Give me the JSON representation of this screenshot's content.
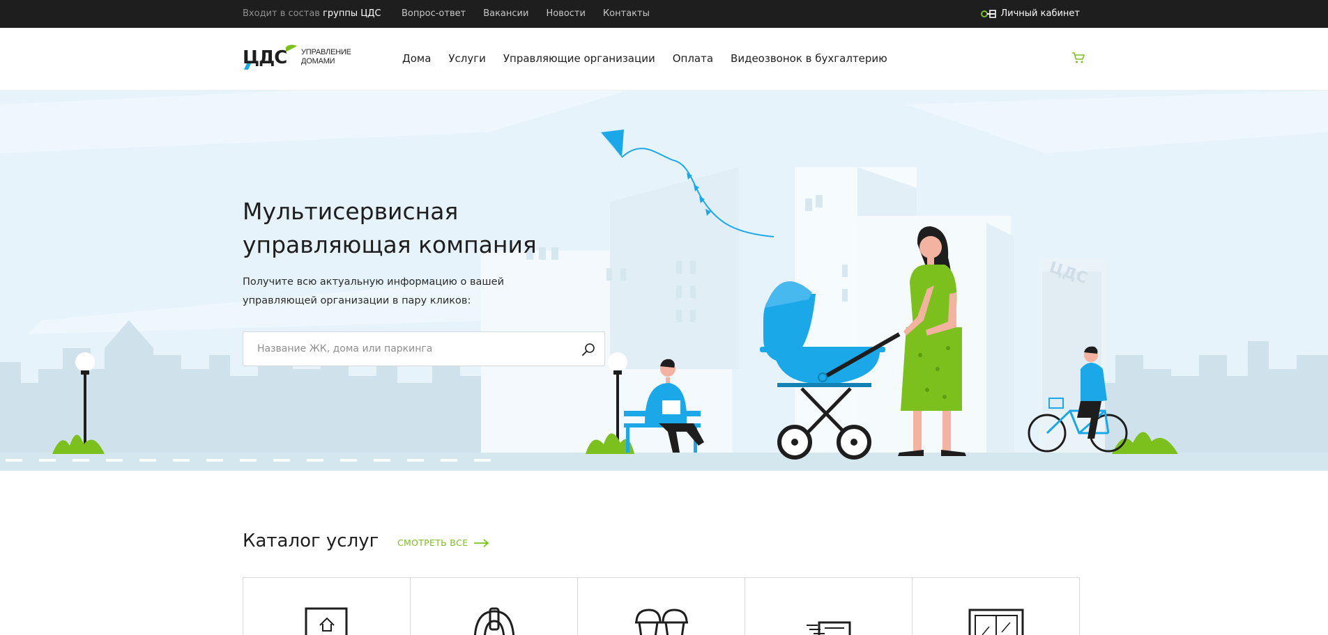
{
  "topbar": {
    "group_prefix": "Входит в состав",
    "group_name": "группы ЦДС",
    "links": [
      "Вопрос-ответ",
      "Вакансии",
      "Новости",
      "Контакты"
    ],
    "cabinet_label": "Личный кабинет",
    "cabinet_icon": "key-icon"
  },
  "header": {
    "logo_mark": "ЦДС",
    "logo_sub_line1": "УПРАВЛЕНИЕ",
    "logo_sub_line2": "ДОМАМИ",
    "nav": [
      "Дома",
      "Услуги",
      "Управляющие организации",
      "Оплата",
      "Видеозвонок в бухгалтерию"
    ],
    "cart_icon": "cart-icon"
  },
  "hero": {
    "title_line1": "Мультисервисная",
    "title_line2": "управляющая компания",
    "subtitle": "Получите всю актуальную информацию о вашей управляющей организации в пару кликов:",
    "search_placeholder": "Название ЖК, дома или паркинга",
    "search_icon": "search-icon",
    "building_logo": "ЦДС"
  },
  "catalog": {
    "title": "Каталог услуг",
    "see_all": "СМОТРЕТЬ ВСЕ",
    "see_all_icon": "arrow-right-icon",
    "cards": [
      "home-document-icon",
      "headset-icon",
      "ice-cream-icon",
      "truck-icon",
      "window-icon"
    ]
  },
  "colors": {
    "accent_green": "#7cc01e",
    "accent_blue": "#1aa8e8",
    "topbar_bg": "#1e1e1e",
    "hero_bg": "#e6f3fb"
  }
}
